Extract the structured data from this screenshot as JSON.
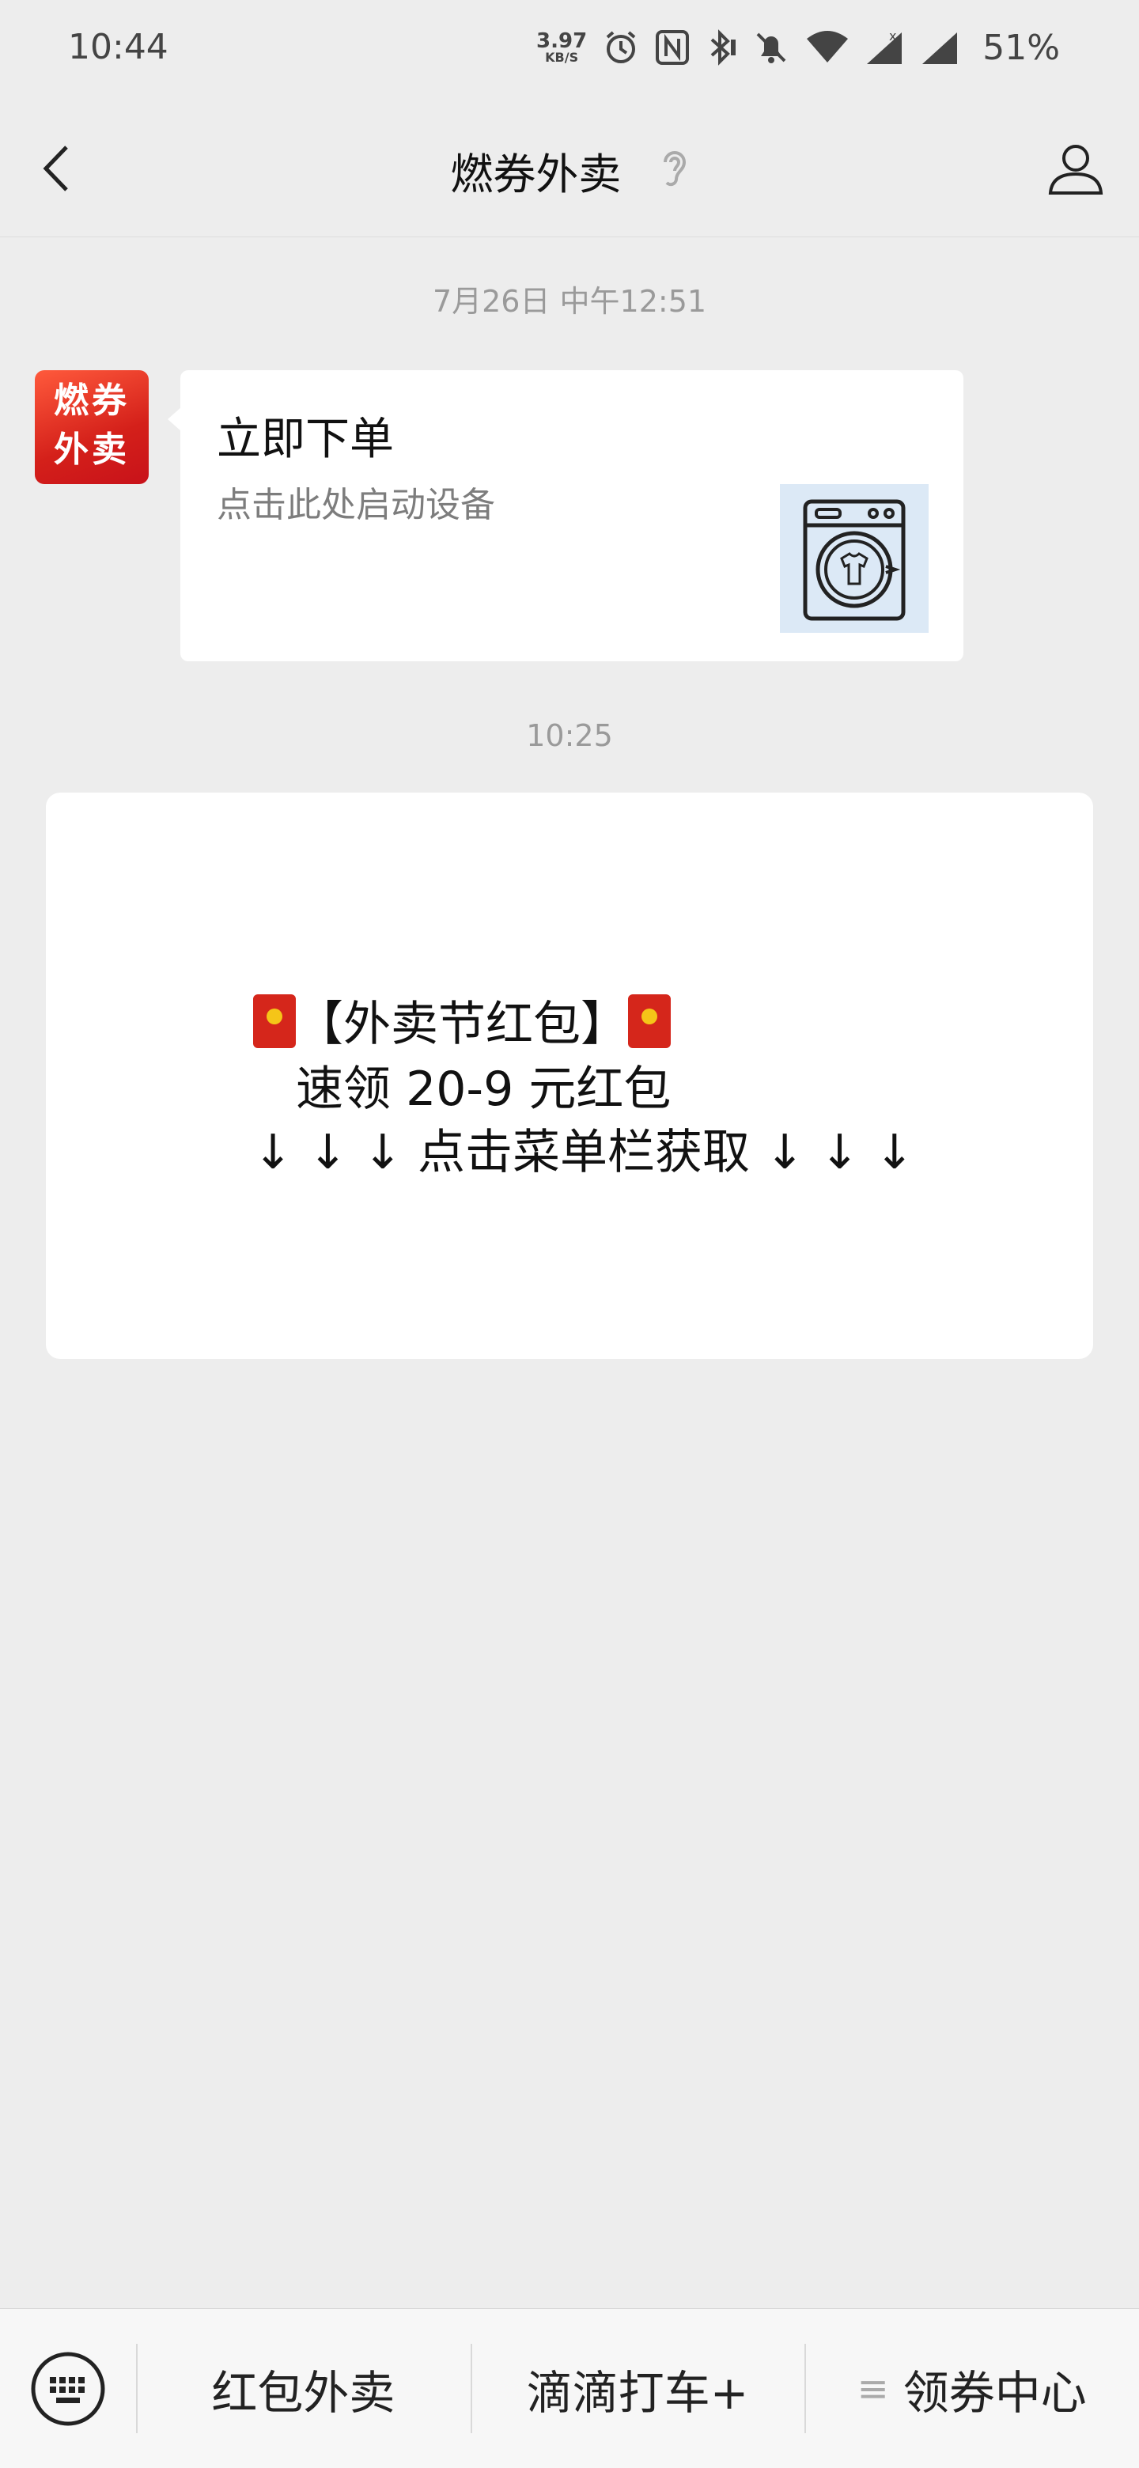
{
  "status_bar": {
    "time": "10:44",
    "net_speed_value": "3.97",
    "net_speed_unit": "KB/S",
    "battery": "51%",
    "icons": [
      "alarm-icon",
      "nfc-icon",
      "bluetooth-icon",
      "mute-icon",
      "wifi-icon",
      "signal-icon",
      "signal-icon-2"
    ]
  },
  "header": {
    "title": "燃券外卖",
    "icons": [
      "back-icon",
      "ear-icon",
      "profile-icon"
    ]
  },
  "chat": {
    "messages": [
      {
        "timestamp": "7月26日 中午12:51",
        "avatar_text": [
          "燃券",
          "外卖"
        ],
        "card_title": "立即下单",
        "card_subtitle": "点击此处启动设备",
        "thumbnail_icon": "washing-machine-icon"
      },
      {
        "timestamp": "10:25",
        "lines": [
          "【外卖节红包】",
          "速领 20-9 元红包",
          "↓ ↓ ↓ 点击菜单栏获取 ↓ ↓ ↓"
        ]
      }
    ]
  },
  "bottom_menu": {
    "keyboard_icon": "keyboard-icon",
    "items": [
      {
        "label": "红包外卖"
      },
      {
        "label": "滴滴打车+"
      },
      {
        "prefix": "≡",
        "label": "领券中心"
      }
    ]
  },
  "colors": {
    "background": "#ededed",
    "card": "#ffffff",
    "envelope_red": "#d5261b",
    "thumbnail_bg": "#dce9f6"
  }
}
